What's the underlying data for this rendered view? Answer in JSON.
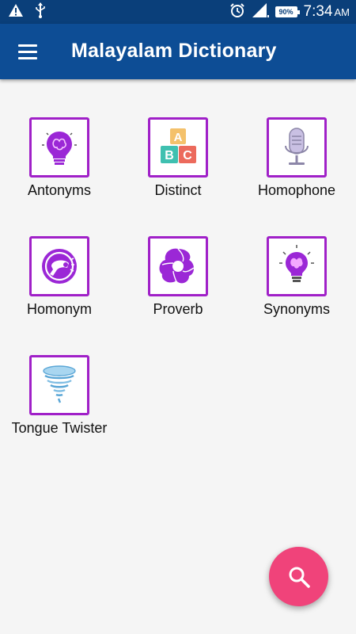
{
  "status_bar": {
    "time": "7:34",
    "ampm": "AM",
    "battery": "90%",
    "icons": [
      "warning-icon",
      "usb-icon",
      "alarm-icon",
      "signal-icon",
      "battery-icon"
    ]
  },
  "app_bar": {
    "title": "Malayalam Dictionary",
    "menu_icon": "menu-icon"
  },
  "categories": [
    {
      "label": "Antonyms",
      "icon": "lightbulb-brain-icon"
    },
    {
      "label": "Distinct",
      "icon": "abc-blocks-icon"
    },
    {
      "label": "Homophone",
      "icon": "microphone-icon"
    },
    {
      "label": "Homonym",
      "icon": "hair-dryer-icon"
    },
    {
      "label": "Proverb",
      "icon": "spiral-icon"
    },
    {
      "label": "Synonyms",
      "icon": "lightbulb-icon"
    },
    {
      "label": "Tongue Twister",
      "icon": "tornado-icon"
    }
  ],
  "fab": {
    "icon": "search-icon"
  },
  "colors": {
    "status_bar": "#0a3f7a",
    "app_bar": "#0d4d95",
    "tile_border": "#a020c8",
    "icon_purple": "#9b27d6",
    "fab": "#f0437a"
  }
}
